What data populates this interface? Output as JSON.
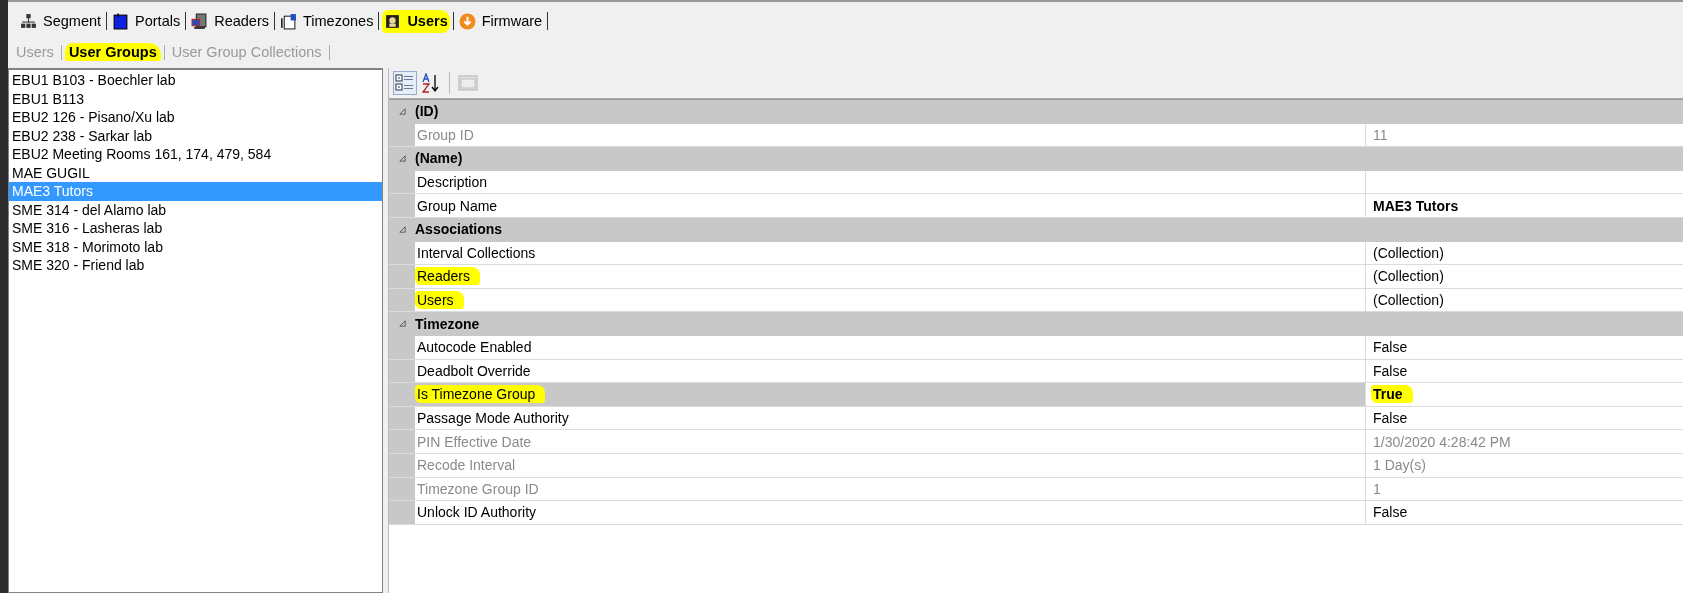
{
  "tabs": [
    {
      "label": "Segment",
      "selected": false,
      "highlighted": false
    },
    {
      "label": "Portals",
      "selected": false,
      "highlighted": false
    },
    {
      "label": "Readers",
      "selected": false,
      "highlighted": false
    },
    {
      "label": "Timezones",
      "selected": false,
      "highlighted": false
    },
    {
      "label": "Users",
      "selected": true,
      "highlighted": true
    },
    {
      "label": "Firmware",
      "selected": false,
      "highlighted": false
    }
  ],
  "subtabs": [
    {
      "label": "Users",
      "selected": false,
      "highlighted": false
    },
    {
      "label": "User Groups",
      "selected": true,
      "highlighted": true
    },
    {
      "label": "User Group Collections",
      "selected": false,
      "highlighted": false
    }
  ],
  "groups": [
    {
      "name": "EBU1 B103 - Boechler lab",
      "selected": false
    },
    {
      "name": "EBU1 B113",
      "selected": false
    },
    {
      "name": "EBU2 126 - Pisano/Xu lab",
      "selected": false
    },
    {
      "name": "EBU2 238 - Sarkar lab",
      "selected": false
    },
    {
      "name": "EBU2 Meeting Rooms 161, 174, 479, 584",
      "selected": false
    },
    {
      "name": "MAE GUGIL",
      "selected": false
    },
    {
      "name": "MAE3 Tutors",
      "selected": true
    },
    {
      "name": "SME 314 - del Alamo lab",
      "selected": false
    },
    {
      "name": "SME 316 - Lasheras lab",
      "selected": false
    },
    {
      "name": "SME 318 - Morimoto lab",
      "selected": false
    },
    {
      "name": "SME 320 - Friend lab",
      "selected": false
    }
  ],
  "property_grid": {
    "categories": [
      {
        "name": "(ID)",
        "expanded": true,
        "properties": [
          {
            "label": "Group ID",
            "value": "11",
            "disabled": true,
            "bold": false,
            "selected": false,
            "highlighted": false,
            "value_highlighted": false
          }
        ]
      },
      {
        "name": "(Name)",
        "expanded": true,
        "properties": [
          {
            "label": "Description",
            "disabled": false,
            "selected": false,
            "highlighted": false
          },
          {
            "label": "Group Name",
            "value": "MAE3 Tutors",
            "disabled": false,
            "bold": true,
            "selected": false,
            "highlighted": false,
            "value_highlighted": false
          }
        ]
      },
      {
        "name": "Associations",
        "expanded": true,
        "properties": [
          {
            "label": "Interval Collections",
            "value": "(Collection)",
            "disabled": false,
            "bold": false,
            "selected": false,
            "highlighted": false,
            "value_highlighted": false
          },
          {
            "label": "Readers",
            "value": "(Collection)",
            "disabled": false,
            "bold": false,
            "selected": false,
            "highlighted": true,
            "value_highlighted": false
          },
          {
            "label": "Users",
            "value": "(Collection)",
            "disabled": false,
            "bold": false,
            "selected": false,
            "highlighted": true,
            "value_highlighted": false
          }
        ]
      },
      {
        "name": "Timezone",
        "expanded": true,
        "properties": [
          {
            "label": "Autocode Enabled",
            "value": "False",
            "disabled": false,
            "bold": false,
            "selected": false,
            "highlighted": false,
            "value_highlighted": false
          },
          {
            "label": "Deadbolt Override",
            "value": "False",
            "disabled": false,
            "bold": false,
            "selected": false,
            "highlighted": false,
            "value_highlighted": false
          },
          {
            "label": "Is Timezone Group",
            "value": "True",
            "disabled": false,
            "bold": true,
            "selected": true,
            "highlighted": true,
            "value_highlighted": true
          },
          {
            "label": "Passage Mode Authority",
            "value": "False",
            "disabled": false,
            "bold": false,
            "selected": false,
            "highlighted": false,
            "value_highlighted": false
          },
          {
            "label": "PIN Effective Date",
            "value": "1/30/2020 4:28:42 PM",
            "disabled": true,
            "bold": false,
            "selected": false,
            "highlighted": false,
            "value_highlighted": false
          },
          {
            "label": "Recode Interval",
            "value": "1 Day(s)",
            "disabled": true,
            "bold": false,
            "selected": false,
            "highlighted": false,
            "value_highlighted": false
          },
          {
            "label": "Timezone Group ID",
            "value": "1",
            "disabled": true,
            "bold": false,
            "selected": false,
            "highlighted": false,
            "value_highlighted": false
          },
          {
            "label": "Unlock ID Authority",
            "value": "False",
            "disabled": false,
            "bold": false,
            "selected": false,
            "highlighted": false,
            "value_highlighted": false
          }
        ]
      }
    ]
  }
}
